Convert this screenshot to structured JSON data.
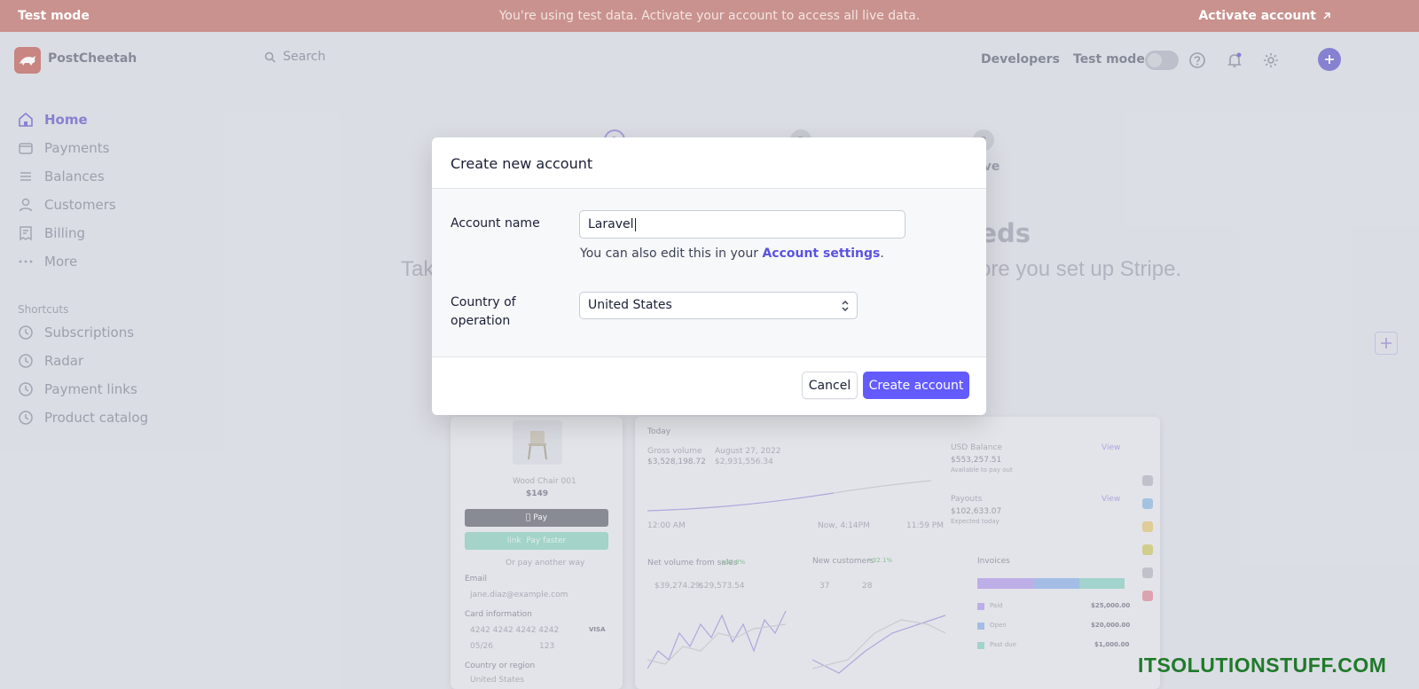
{
  "banner": {
    "left_label": "Test mode",
    "message": "You're using test data. Activate your account to access all live data.",
    "action_label": "Activate account",
    "action_icon": "arrow-up-right-icon"
  },
  "header": {
    "brand": "PostCheetah",
    "search_placeholder": "Search",
    "developers_label": "Developers",
    "test_mode_label": "Test mode",
    "test_mode_on": false
  },
  "sidebar": {
    "items": [
      {
        "label": "Home",
        "icon": "home-icon",
        "active": true
      },
      {
        "label": "Payments",
        "icon": "wallet-icon"
      },
      {
        "label": "Balances",
        "icon": "balances-icon"
      },
      {
        "label": "Customers",
        "icon": "user-icon"
      },
      {
        "label": "Billing",
        "icon": "billing-icon"
      },
      {
        "label": "More",
        "icon": "more-icon"
      }
    ],
    "shortcuts_label": "Shortcuts",
    "shortcuts": [
      {
        "label": "Subscriptions",
        "icon": "clock-icon"
      },
      {
        "label": "Radar",
        "icon": "clock-icon"
      },
      {
        "label": "Payment links",
        "icon": "clock-icon"
      },
      {
        "label": "Product catalog",
        "icon": "clock-icon"
      }
    ]
  },
  "background": {
    "steps": [
      "1",
      "2",
      "3"
    ],
    "step3_label_fragment": "ive",
    "heading_fragment": "needs",
    "subtitle_left_fragment": "Tak",
    "subtitle_right_fragment": "ore you set up Stripe."
  },
  "preview": {
    "product_name": "Wood Chair 001",
    "price": "$149",
    "apple_pay": "Pay",
    "link_pay": "Pay faster",
    "or_pay": "Or pay another way",
    "email_label": "Email",
    "email_value": "jane.diaz@example.com",
    "card_label": "Card information",
    "card_number": "4242 4242 4242 4242",
    "card_brand": "VISA",
    "card_exp": "05/26",
    "card_cvc": "123",
    "country_label": "Country or region",
    "country_value": "United States",
    "today": "Today",
    "gross_volume_label": "Gross volume",
    "gross_volume": "$3,528,198.72",
    "compare_date": "August 27, 2022",
    "compare_value": "$2,931,556.34",
    "usd_balance_label": "USD Balance",
    "usd_balance": "$553,257.51",
    "available": "Available to pay out",
    "payouts_label": "Payouts",
    "payouts": "$102,633.07",
    "expected": "Expected today",
    "view": "View",
    "time_start": "12:00 AM",
    "time_now": "Now, 4:14PM",
    "time_end": "11:59 PM",
    "net_volume_label": "Net volume from sales",
    "net_volume_badge": "+32.8%",
    "net_last": "$39,274.29",
    "net_prev": "$29,573.54",
    "new_customers_label": "New customers",
    "new_customers_badge": "+32.1%",
    "cust_last": "37",
    "cust_prev": "28",
    "invoices_label": "Invoices",
    "invoice_rows": [
      {
        "label": "Paid",
        "value": "$25,000.00",
        "color": "#c4b5f0"
      },
      {
        "label": "Open",
        "value": "$20,000.00",
        "color": "#a9c4ee"
      },
      {
        "label": "Past due",
        "value": "$1,000.00",
        "color": "#a8dcd4"
      }
    ]
  },
  "modal": {
    "title": "Create new account",
    "account_name_label": "Account name",
    "account_name_value": "Laravel",
    "help_prefix": "You can also edit this in your ",
    "help_link": "Account settings",
    "help_suffix": ".",
    "country_label_line1": "Country of",
    "country_label_line2": "operation",
    "country_value": "United States",
    "cancel_label": "Cancel",
    "create_label": "Create account"
  },
  "watermark": "ITSOLUTIONSTUFF.COM",
  "colors": {
    "accent": "#635bff",
    "banner": "#c9928e",
    "watermark": "#1f7a2a"
  }
}
